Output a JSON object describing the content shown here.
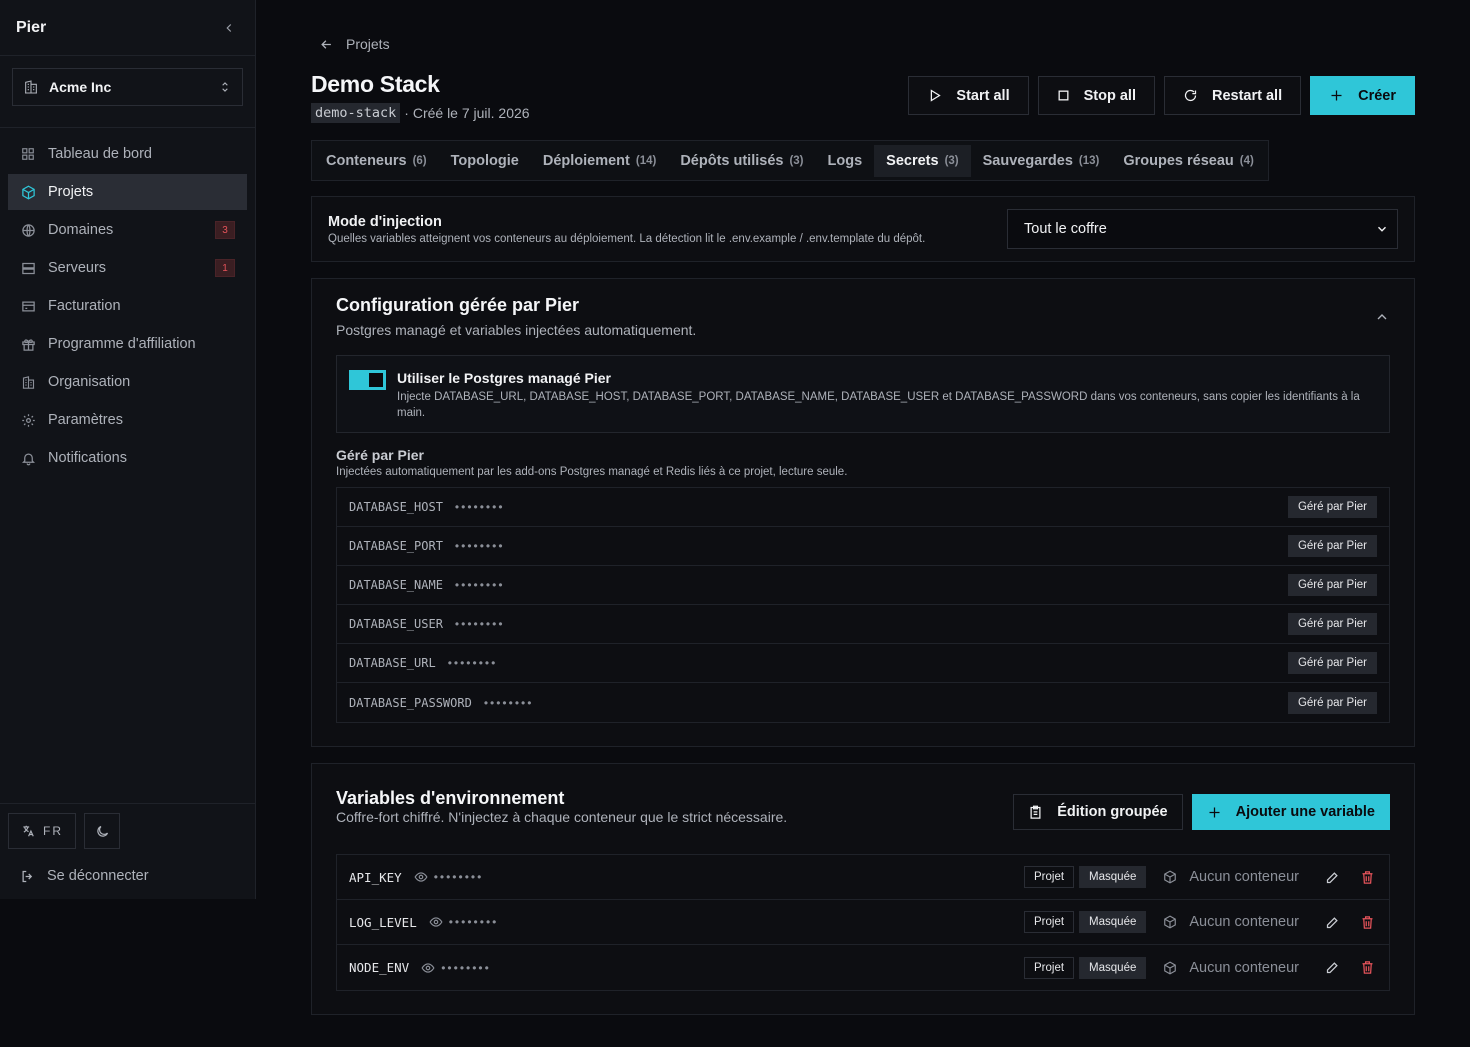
{
  "app": {
    "name": "Pier"
  },
  "org": {
    "name": "Acme Inc"
  },
  "sidebar": {
    "items": [
      {
        "label": "Tableau de bord",
        "icon": "grid-icon"
      },
      {
        "label": "Projets",
        "icon": "cube-icon",
        "active": true
      },
      {
        "label": "Domaines",
        "icon": "globe-icon",
        "badge": "3"
      },
      {
        "label": "Serveurs",
        "icon": "server-icon",
        "badge": "1"
      },
      {
        "label": "Facturation",
        "icon": "credit-card-icon"
      },
      {
        "label": "Programme d'affiliation",
        "icon": "gift-icon"
      },
      {
        "label": "Organisation",
        "icon": "building-icon"
      },
      {
        "label": "Paramètres",
        "icon": "gear-icon"
      },
      {
        "label": "Notifications",
        "icon": "bell-icon"
      }
    ],
    "language": "FR",
    "logout_label": "Se déconnecter"
  },
  "breadcrumb": {
    "label": "Projets"
  },
  "project": {
    "title": "Demo Stack",
    "slug": "demo-stack",
    "created": "· Créé le 7 juil. 2026"
  },
  "actions": {
    "start_all": "Start all",
    "stop_all": "Stop all",
    "restart_all": "Restart all",
    "create": "Créer"
  },
  "tabs": [
    {
      "label": "Conteneurs",
      "count": "(6)"
    },
    {
      "label": "Topologie",
      "count": ""
    },
    {
      "label": "Déploiement",
      "count": "(14)"
    },
    {
      "label": "Dépôts utilisés",
      "count": "(3)"
    },
    {
      "label": "Logs",
      "count": ""
    },
    {
      "label": "Secrets",
      "count": "(3)",
      "active": true
    },
    {
      "label": "Sauvegardes",
      "count": "(13)"
    },
    {
      "label": "Groupes réseau",
      "count": "(4)"
    }
  ],
  "injection": {
    "title": "Mode d'injection",
    "description": "Quelles variables atteignent vos conteneurs au déploiement. La détection lit le .env.example / .env.template du dépôt.",
    "selected": "Tout le coffre"
  },
  "managed_config": {
    "title": "Configuration gérée par Pier",
    "subtitle": "Postgres managé et variables injectées automatiquement.",
    "toggle": {
      "enabled": true,
      "title": "Utiliser le Postgres managé Pier",
      "description": "Injecte DATABASE_URL, DATABASE_HOST, DATABASE_PORT, DATABASE_NAME, DATABASE_USER et DATABASE_PASSWORD dans vos conteneurs, sans copier les identifiants à la main."
    },
    "managed_section_title": "Géré par Pier",
    "managed_section_desc": "Injectées automatiquement par les add-ons Postgres managé et Redis liés à ce projet, lecture seule.",
    "secrets": [
      {
        "key": "DATABASE_HOST",
        "value": "••••••••",
        "badge": "Géré par Pier"
      },
      {
        "key": "DATABASE_PORT",
        "value": "••••••••",
        "badge": "Géré par Pier"
      },
      {
        "key": "DATABASE_NAME",
        "value": "••••••••",
        "badge": "Géré par Pier"
      },
      {
        "key": "DATABASE_USER",
        "value": "••••••••",
        "badge": "Géré par Pier"
      },
      {
        "key": "DATABASE_URL",
        "value": "••••••••",
        "badge": "Géré par Pier"
      },
      {
        "key": "DATABASE_PASSWORD",
        "value": "••••••••",
        "badge": "Géré par Pier"
      }
    ]
  },
  "env_vars": {
    "title": "Variables d'environnement",
    "subtitle": "Coffre-fort chiffré. N'injectez à chaque conteneur que le strict nécessaire.",
    "bulk_edit": "Édition groupée",
    "add_variable": "Ajouter une variable",
    "rows": [
      {
        "key": "API_KEY",
        "value": "••••••••",
        "scope": "Projet",
        "visibility": "Masquée",
        "containers": "Aucun conteneur"
      },
      {
        "key": "LOG_LEVEL",
        "value": "••••••••",
        "scope": "Projet",
        "visibility": "Masquée",
        "containers": "Aucun conteneur"
      },
      {
        "key": "NODE_ENV",
        "value": "••••••••",
        "scope": "Projet",
        "visibility": "Masquée",
        "containers": "Aucun conteneur"
      }
    ]
  },
  "colors": {
    "accent": "#2fc6d8",
    "danger": "#e5535a",
    "background": "#0a0b0f",
    "sidebar": "#111318"
  }
}
